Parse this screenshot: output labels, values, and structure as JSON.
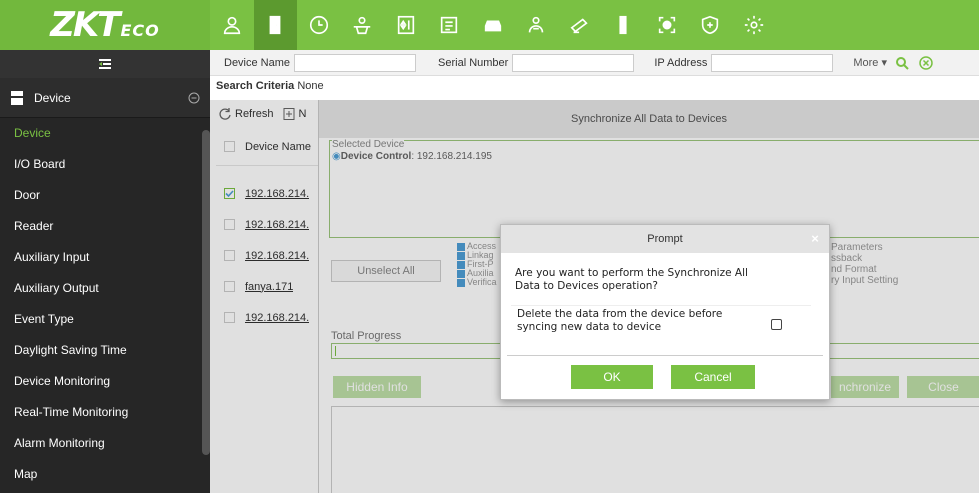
{
  "brand": {
    "logo_main": "ZKT",
    "logo_sub": "ECO"
  },
  "top_nav": [
    {
      "icon": "person-icon"
    },
    {
      "icon": "door-icon"
    },
    {
      "icon": "clock-icon"
    },
    {
      "icon": "visitor-icon"
    },
    {
      "icon": "elevator-icon"
    },
    {
      "icon": "attendance-icon"
    },
    {
      "icon": "car-icon"
    },
    {
      "icon": "patrol-icon"
    },
    {
      "icon": "video-icon"
    },
    {
      "icon": "smart-card-icon"
    },
    {
      "icon": "face-icon"
    },
    {
      "icon": "shield-plus-icon"
    },
    {
      "icon": "gear-icon"
    }
  ],
  "sidebar": {
    "module_label": "Device",
    "items": [
      {
        "label": "Device"
      },
      {
        "label": "I/O Board"
      },
      {
        "label": "Door"
      },
      {
        "label": "Reader"
      },
      {
        "label": "Auxiliary Input"
      },
      {
        "label": "Auxiliary Output"
      },
      {
        "label": "Event Type"
      },
      {
        "label": "Daylight Saving Time"
      },
      {
        "label": "Device Monitoring"
      },
      {
        "label": "Real-Time Monitoring"
      },
      {
        "label": "Alarm Monitoring"
      },
      {
        "label": "Map"
      }
    ]
  },
  "search": {
    "device_name_label": "Device Name",
    "serial_label": "Serial Number",
    "ip_label": "IP Address",
    "more_label": "More",
    "criteria_label": "Search Criteria",
    "criteria_value": "None"
  },
  "toolbar": {
    "refresh_label": "Refresh",
    "new_label": "N"
  },
  "table": {
    "header": "Device Name",
    "rows": [
      {
        "name": "192.168.214.",
        "checked": true
      },
      {
        "name": "192.168.214.",
        "checked": false
      },
      {
        "name": "192.168.214.",
        "checked": false
      },
      {
        "name": "fanya.171",
        "checked": false
      },
      {
        "name": "192.168.214.",
        "checked": false
      }
    ]
  },
  "sync_dialog": {
    "title": "Synchronize All Data to Devices",
    "selected_label": "Selected Device",
    "device_control_label": "Device Control",
    "device_control_value": ": 192.168.214.195",
    "unselect_label": "Unselect All",
    "options_left": [
      "Access",
      "Linkag",
      "First-P",
      "Auxilia",
      "Verifica"
    ],
    "options_right": [
      "Parameters",
      "ssback",
      "nd Format",
      "ry Input Setting"
    ],
    "progress_label": "Total Progress",
    "hidden_info_label": "Hidden Info",
    "synchronize_label": "nchronize",
    "close_label": "Close"
  },
  "prompt": {
    "title": "Prompt",
    "close_glyph": "×",
    "message": "Are you want to perform the Synchronize All Data to Devices operation?",
    "option_text": "Delete the data from the device before syncing new data to device",
    "ok_label": "OK",
    "cancel_label": "Cancel"
  },
  "colors": {
    "accent": "#7ac143",
    "sidebar_bg": "#262626"
  }
}
